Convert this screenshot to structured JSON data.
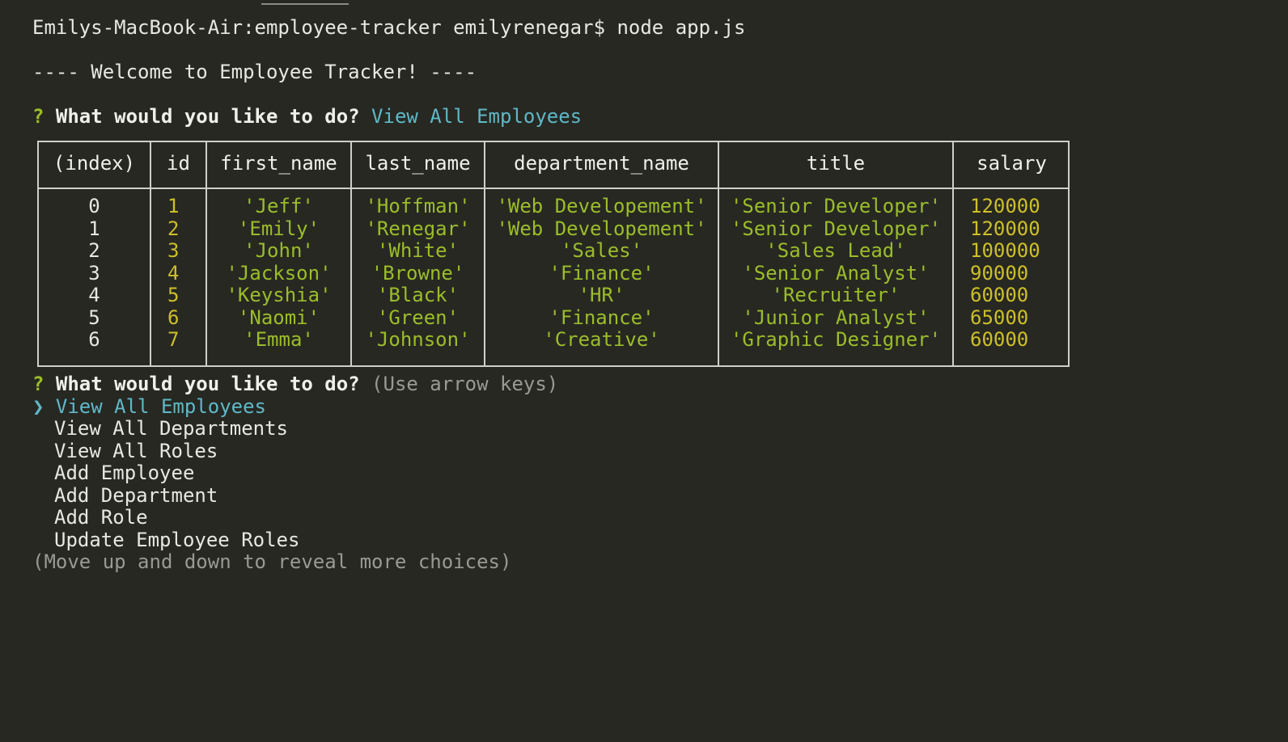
{
  "terminal": {
    "command_line": "Emilys-MacBook-Air:employee-tracker emilyrenegar$ node app.js",
    "welcome": "---- Welcome to Employee Tracker! ----",
    "prompt1": {
      "mark": "?",
      "question": "What would you like to do?",
      "answer": "View All Employees"
    },
    "prompt2": {
      "mark": "?",
      "question": "What would you like to do?",
      "hint": "(Use arrow keys)"
    },
    "pointer": "❯",
    "menu": [
      "View All Employees",
      "View All Departments",
      "View All Roles",
      "Add Employee",
      "Add Department",
      "Add Role",
      "Update Employee Roles"
    ],
    "more_hint": "(Move up and down to reveal more choices)"
  },
  "table": {
    "headers": [
      "(index)",
      "id",
      "first_name",
      "last_name",
      "department_name",
      "title",
      "salary"
    ],
    "rows": [
      [
        "0",
        "1",
        "'Jeff'",
        "'Hoffman'",
        "'Web Developement'",
        "'Senior Developer'",
        "120000"
      ],
      [
        "1",
        "2",
        "'Emily'",
        "'Renegar'",
        "'Web Developement'",
        "'Senior Developer'",
        "120000"
      ],
      [
        "2",
        "3",
        "'John'",
        "'White'",
        "'Sales'",
        "'Sales Lead'",
        "100000"
      ],
      [
        "3",
        "4",
        "'Jackson'",
        "'Browne'",
        "'Finance'",
        "'Senior Analyst'",
        "90000"
      ],
      [
        "4",
        "5",
        "'Keyshia'",
        "'Black'",
        "'HR'",
        "'Recruiter'",
        "60000"
      ],
      [
        "5",
        "6",
        "'Naomi'",
        "'Green'",
        "'Finance'",
        "'Junior Analyst'",
        "65000"
      ],
      [
        "6",
        "7",
        "'Emma'",
        "'Johnson'",
        "'Creative'",
        "'Graphic Designer'",
        "60000"
      ]
    ]
  },
  "colors": {
    "background": "#272822",
    "prompt_mark": "#9bbd2a",
    "answer": "#5fb8c8",
    "string_value": "#9bbd2a",
    "number_value": "#cdbf2a",
    "hint": "#9a9a94"
  }
}
